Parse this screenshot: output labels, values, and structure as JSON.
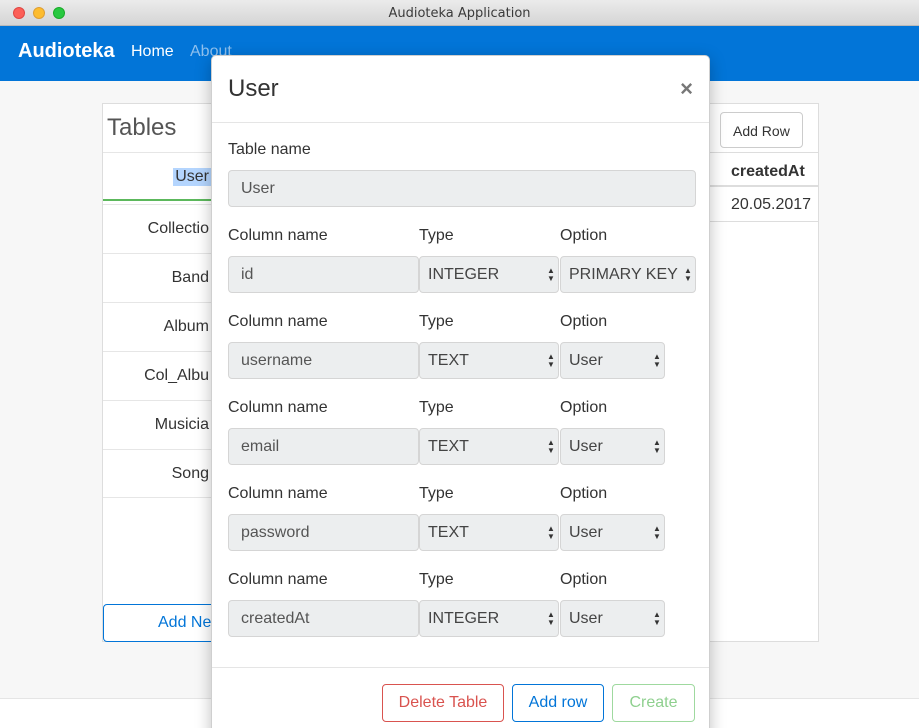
{
  "window": {
    "title": "Audioteka Application"
  },
  "navbar": {
    "brand": "Audioteka",
    "links": [
      {
        "label": "Home"
      },
      {
        "label": "About"
      }
    ]
  },
  "tables_panel": {
    "heading": "Tables",
    "items": [
      {
        "label": "User",
        "active": true
      },
      {
        "label": "Collectio"
      },
      {
        "label": "Band"
      },
      {
        "label": "Album"
      },
      {
        "label": "Col_Albu"
      },
      {
        "label": "Musicia"
      },
      {
        "label": "Song"
      }
    ],
    "add_new_label": "Add Ne"
  },
  "data_table": {
    "add_row_label": "Add Row",
    "header": "createdAt",
    "cell": "20.05.2017"
  },
  "modal": {
    "title": "User",
    "close_glyph": "×",
    "table_name_label": "Table name",
    "table_name_value": "User",
    "column_label": "Column name",
    "type_label": "Type",
    "option_label": "Option",
    "columns": [
      {
        "name": "id",
        "type": "INTEGER",
        "option": "PRIMARY KEY"
      },
      {
        "name": "username",
        "type": "TEXT",
        "option": "User"
      },
      {
        "name": "email",
        "type": "TEXT",
        "option": "User"
      },
      {
        "name": "password",
        "type": "TEXT",
        "option": "User"
      },
      {
        "name": "createdAt",
        "type": "INTEGER",
        "option": "User"
      }
    ],
    "buttons": {
      "delete": "Delete Table",
      "add_row": "Add row",
      "create": "Create"
    }
  },
  "colors": {
    "navbar": "#0275d8",
    "danger": "#d9534f",
    "success": "#5cb85c"
  },
  "icons": {
    "close": "close-icon",
    "select_arrows": "select-arrows-icon"
  }
}
